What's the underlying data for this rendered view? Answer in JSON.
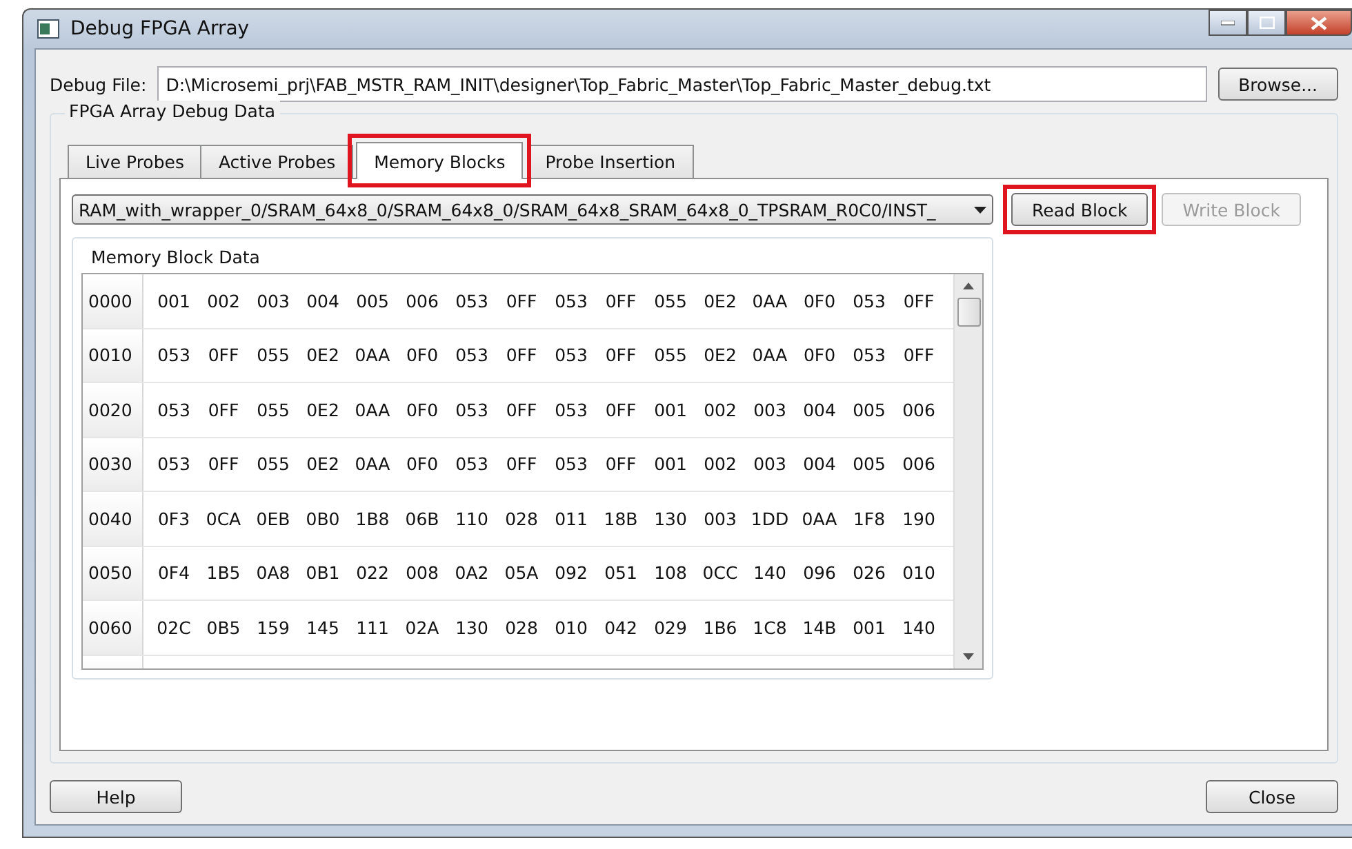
{
  "window": {
    "title": "Debug FPGA Array"
  },
  "debug_file": {
    "label": "Debug File:",
    "value": "D:\\Microsemi_prj\\FAB_MSTR_RAM_INIT\\designer\\Top_Fabric_Master\\Top_Fabric_Master_debug.txt",
    "browse": "Browse..."
  },
  "group": {
    "title": "FPGA Array Debug Data"
  },
  "tabs": [
    {
      "label": "Live Probes",
      "selected": false,
      "highlighted": false
    },
    {
      "label": "Active Probes",
      "selected": false,
      "highlighted": false
    },
    {
      "label": "Memory Blocks",
      "selected": true,
      "highlighted": true
    },
    {
      "label": "Probe Insertion",
      "selected": false,
      "highlighted": false
    }
  ],
  "block_select": {
    "value": "RAM_with_wrapper_0/SRAM_64x8_0/SRAM_64x8_0/SRAM_64x8_SRAM_64x8_0_TPSRAM_R0C0/INST_"
  },
  "buttons": [
    {
      "label": "Read Block",
      "disabled": false,
      "highlighted": true
    },
    {
      "label": "Write Block",
      "disabled": true
    }
  ],
  "memory": {
    "title": "Memory Block Data",
    "rows": [
      {
        "address": "0000",
        "values": [
          "001",
          "002",
          "003",
          "004",
          "005",
          "006",
          "053",
          "0FF",
          "053",
          "0FF",
          "055",
          "0E2",
          "0AA",
          "0F0",
          "053",
          "0FF"
        ]
      },
      {
        "address": "0010",
        "values": [
          "053",
          "0FF",
          "055",
          "0E2",
          "0AA",
          "0F0",
          "053",
          "0FF",
          "053",
          "0FF",
          "055",
          "0E2",
          "0AA",
          "0F0",
          "053",
          "0FF"
        ]
      },
      {
        "address": "0020",
        "values": [
          "053",
          "0FF",
          "055",
          "0E2",
          "0AA",
          "0F0",
          "053",
          "0FF",
          "053",
          "0FF",
          "001",
          "002",
          "003",
          "004",
          "005",
          "006"
        ]
      },
      {
        "address": "0030",
        "values": [
          "053",
          "0FF",
          "055",
          "0E2",
          "0AA",
          "0F0",
          "053",
          "0FF",
          "053",
          "0FF",
          "001",
          "002",
          "003",
          "004",
          "005",
          "006"
        ]
      },
      {
        "address": "0040",
        "values": [
          "0F3",
          "0CA",
          "0EB",
          "0B0",
          "1B8",
          "06B",
          "110",
          "028",
          "011",
          "18B",
          "130",
          "003",
          "1DD",
          "0AA",
          "1F8",
          "190"
        ]
      },
      {
        "address": "0050",
        "values": [
          "0F4",
          "1B5",
          "0A8",
          "0B1",
          "022",
          "008",
          "0A2",
          "05A",
          "092",
          "051",
          "108",
          "0CC",
          "140",
          "096",
          "026",
          "010"
        ]
      },
      {
        "address": "0060",
        "values": [
          "02C",
          "0B5",
          "159",
          "145",
          "111",
          "02A",
          "130",
          "028",
          "010",
          "042",
          "029",
          "1B6",
          "1C8",
          "14B",
          "001",
          "140"
        ]
      }
    ]
  },
  "footer": {
    "help": "Help",
    "close": "Close"
  }
}
